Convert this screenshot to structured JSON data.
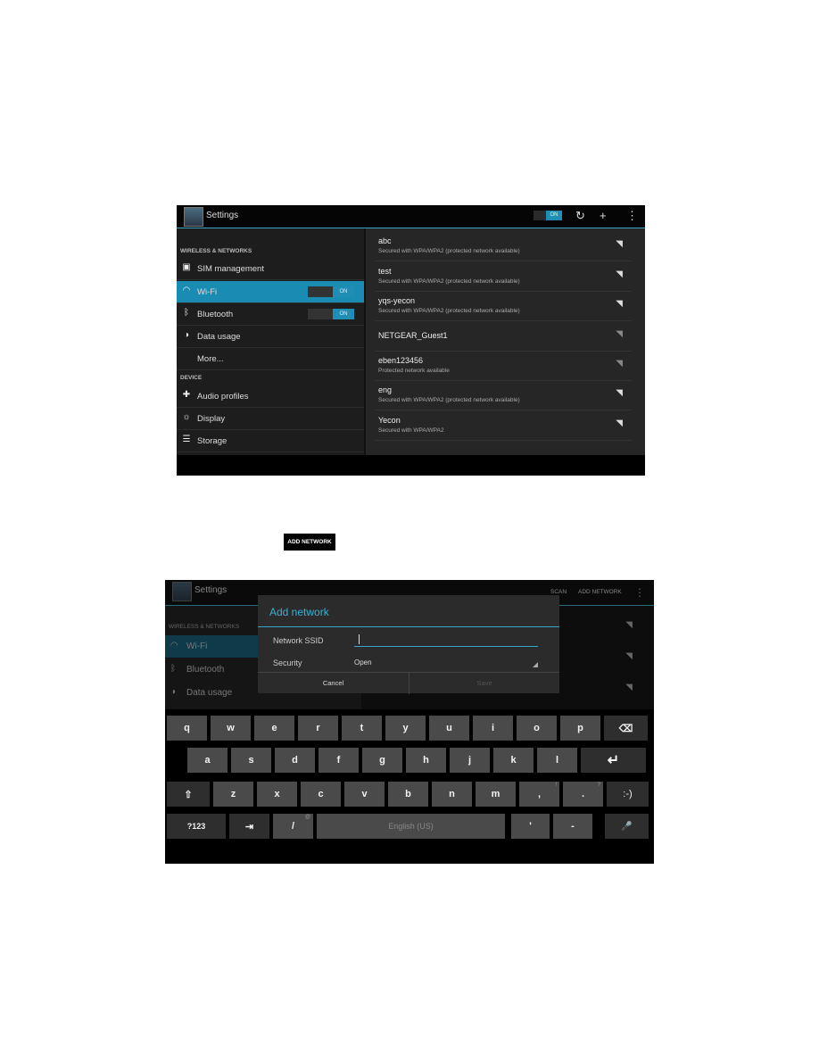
{
  "screen1": {
    "title": "Settings",
    "top_toggle": "ON",
    "sections": [
      "WIRELESS & NETWORKS",
      "DEVICE"
    ],
    "items": [
      {
        "label": "SIM management",
        "icon": "sim-icon"
      },
      {
        "label": "Wi-Fi",
        "icon": "wifi-icon",
        "toggle": "ON",
        "selected": true
      },
      {
        "label": "Bluetooth",
        "icon": "bluetooth-icon",
        "toggle": "ON"
      },
      {
        "label": "Data usage",
        "icon": "data-usage-icon"
      },
      {
        "label": "More...",
        "icon": ""
      },
      {
        "label": "Audio profiles",
        "icon": "audio-icon"
      },
      {
        "label": "Display",
        "icon": "display-icon"
      },
      {
        "label": "Storage",
        "icon": "storage-icon"
      }
    ],
    "networks": [
      {
        "name": "abc",
        "detail": "Secured with WPA/WPA2 (protected network available)"
      },
      {
        "name": "test",
        "detail": "Secured with WPA/WPA2 (protected network available)"
      },
      {
        "name": "yqs-yecon",
        "detail": "Secured with WPA/WPA2 (protected network available)"
      },
      {
        "name": "NETGEAR_Guest1",
        "detail": ""
      },
      {
        "name": "eben123456",
        "detail": "Protected network available"
      },
      {
        "name": "eng",
        "detail": "Secured with WPA/WPA2 (protected network available)"
      },
      {
        "name": "Yecon",
        "detail": "Secured with WPA/WPA2"
      }
    ]
  },
  "add_network_button": "ADD NETWORK",
  "screen2": {
    "title": "Settings",
    "scan": "SCAN",
    "add_network": "ADD NETWORK",
    "section": "WIRELESS & NETWORKS",
    "items": [
      "Wi-Fi",
      "Bluetooth",
      "Data usage"
    ],
    "dialog": {
      "title": "Add network",
      "ssid_label": "Network SSID",
      "ssid_value": "",
      "security_label": "Security",
      "security_value": "Open",
      "cancel": "Cancel",
      "save": "Save"
    },
    "keyboard": {
      "row1": [
        "q",
        "w",
        "e",
        "r",
        "t",
        "y",
        "u",
        "i",
        "o",
        "p",
        "⌫"
      ],
      "row2": [
        "a",
        "s",
        "d",
        "f",
        "g",
        "h",
        "j",
        "k",
        "l",
        "↵"
      ],
      "row3": [
        "⇧",
        "z",
        "x",
        "c",
        "v",
        "b",
        "n",
        "m",
        ",",
        ".",
        ":-)"
      ],
      "row3_hints": {
        "comma": "!",
        "period": "?"
      },
      "row4": [
        "?123",
        "⇥",
        "/",
        "English (US)",
        "'",
        "-",
        "🎤"
      ],
      "row4_hints": {
        "slash": "@"
      }
    }
  }
}
